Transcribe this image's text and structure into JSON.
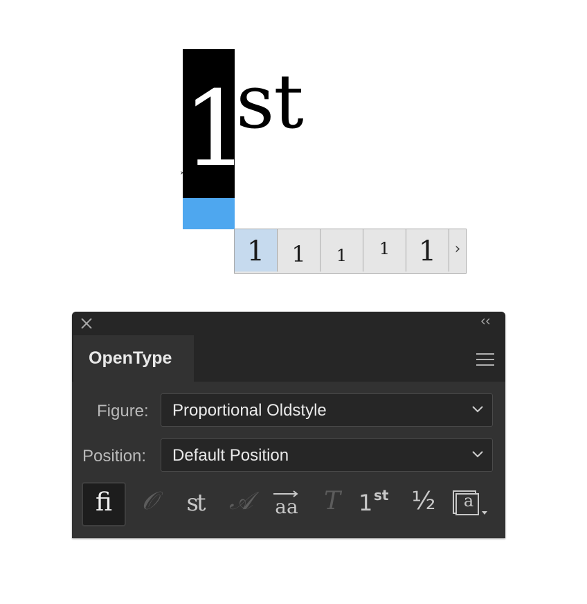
{
  "canvas": {
    "selected_glyph": "1",
    "trailing_text": "st",
    "alternates": [
      "1",
      "1",
      "1",
      "1",
      "1"
    ],
    "more_alternates_glyph": "›"
  },
  "panel": {
    "tab_title": "OpenType",
    "figure": {
      "label": "Figure:",
      "value": "Proportional Oldstyle"
    },
    "position": {
      "label": "Position:",
      "value": "Default Position"
    },
    "icons": [
      {
        "name": "standard-ligatures-icon",
        "glyph": "ﬁ",
        "active": true,
        "enabled": true
      },
      {
        "name": "contextual-alternates-icon",
        "glyph": "𝒪",
        "active": false,
        "enabled": false
      },
      {
        "name": "discretionary-ligatures-icon",
        "glyph": "st",
        "active": false,
        "enabled": true
      },
      {
        "name": "swash-icon",
        "glyph": "𝒜",
        "active": false,
        "enabled": false
      },
      {
        "name": "stylistic-alternates-icon",
        "glyph": "aa",
        "active": false,
        "enabled": true
      },
      {
        "name": "titling-alternates-icon",
        "glyph": "T",
        "active": false,
        "enabled": false
      },
      {
        "name": "ordinals-icon",
        "glyph": "1st",
        "active": false,
        "enabled": true
      },
      {
        "name": "fractions-icon",
        "glyph": "½",
        "active": false,
        "enabled": true
      },
      {
        "name": "stylistic-sets-icon",
        "glyph": "a",
        "active": false,
        "enabled": true
      }
    ]
  },
  "colors": {
    "selection_highlight": "#4ea7ef",
    "panel_bg": "#323232",
    "panel_dark": "#262626"
  }
}
